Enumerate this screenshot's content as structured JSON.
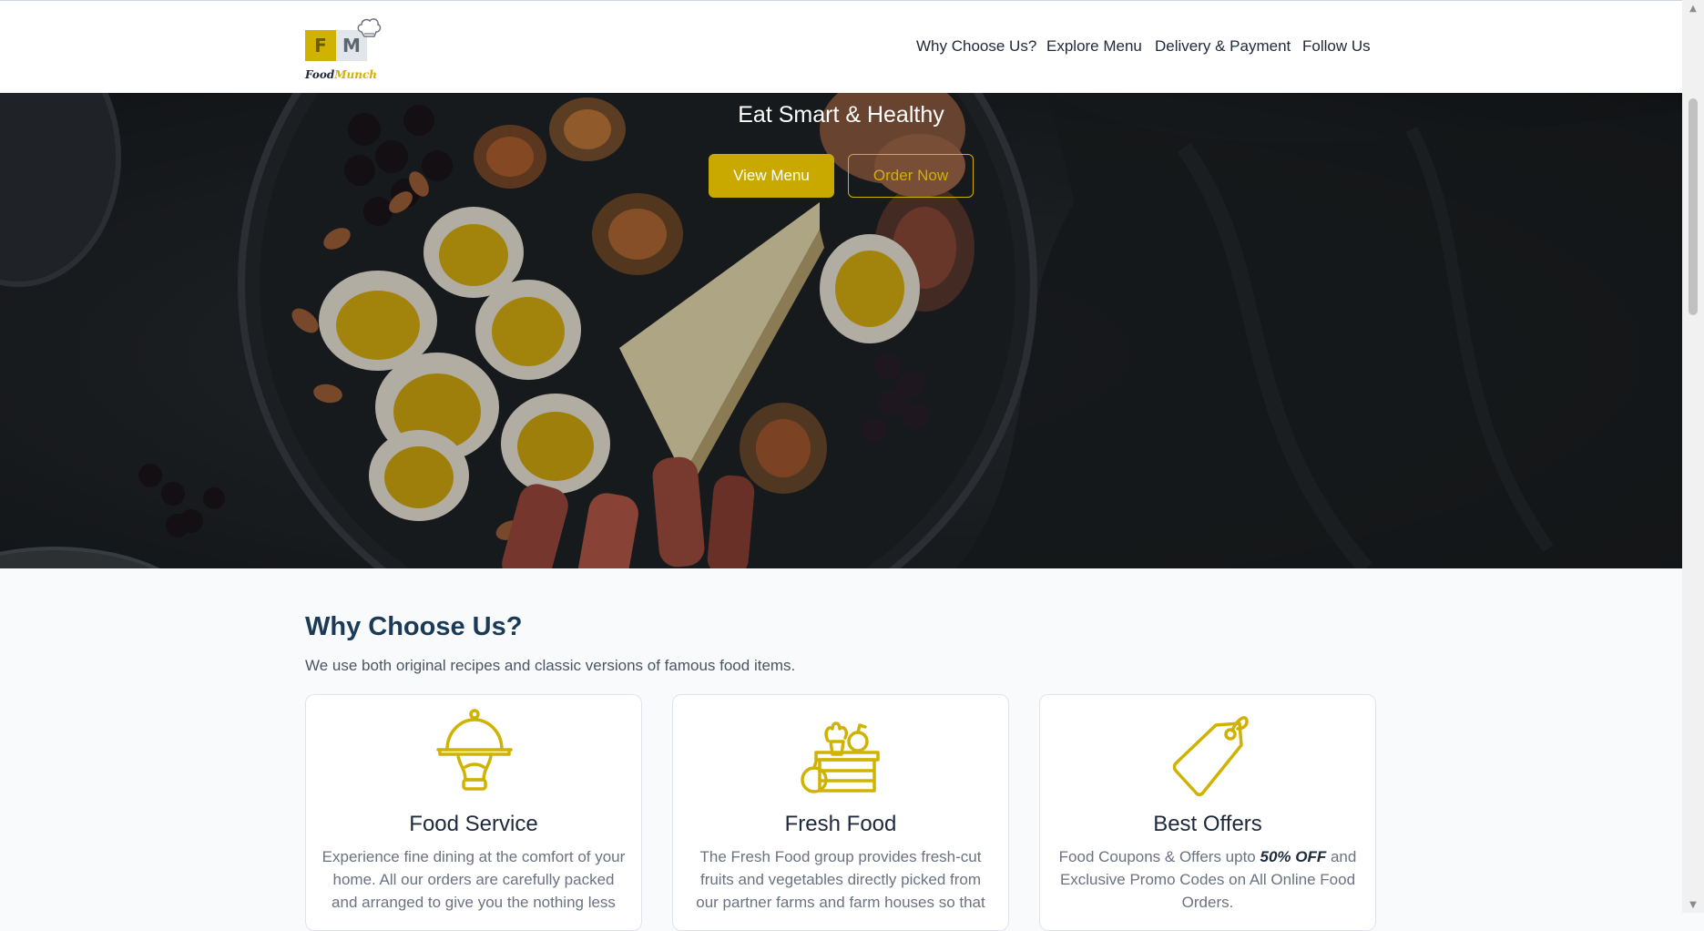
{
  "brand": {
    "logo_f": "F",
    "logo_m": "M",
    "name_part1": "Food",
    "name_part2": "Munch"
  },
  "nav": {
    "items": [
      {
        "label": "Why Choose Us?"
      },
      {
        "label": "Explore Menu"
      },
      {
        "label": "Delivery & Payment"
      },
      {
        "label": "Follow Us"
      }
    ]
  },
  "hero": {
    "title": "Eat Smart & Healthy",
    "view_menu_label": "View Menu",
    "order_now_label": "Order Now"
  },
  "why": {
    "title": "Why Choose Us?",
    "subtitle": "We use both original recipes and classic versions of famous food items.",
    "cards": [
      {
        "title": "Food Service",
        "icon": "cloche-icon",
        "text": "Experience fine dining at the comfort of your home. All our orders are carefully packed and arranged to give you the nothing less"
      },
      {
        "title": "Fresh Food",
        "icon": "fresh-basket-icon",
        "text": "The Fresh Food group provides fresh-cut fruits and vegetables directly picked from our partner farms and farm houses so that"
      },
      {
        "title": "Best Offers",
        "icon": "price-tag-icon",
        "text_before": "Food Coupons & Offers upto ",
        "text_bold": "50% OFF",
        "text_after": " and Exclusive Promo Codes on All Online Food Orders."
      }
    ]
  },
  "colors": {
    "accent": "#d0b200",
    "heading": "#1b3a57",
    "text": "#1e293b",
    "muted": "#6b7280"
  }
}
